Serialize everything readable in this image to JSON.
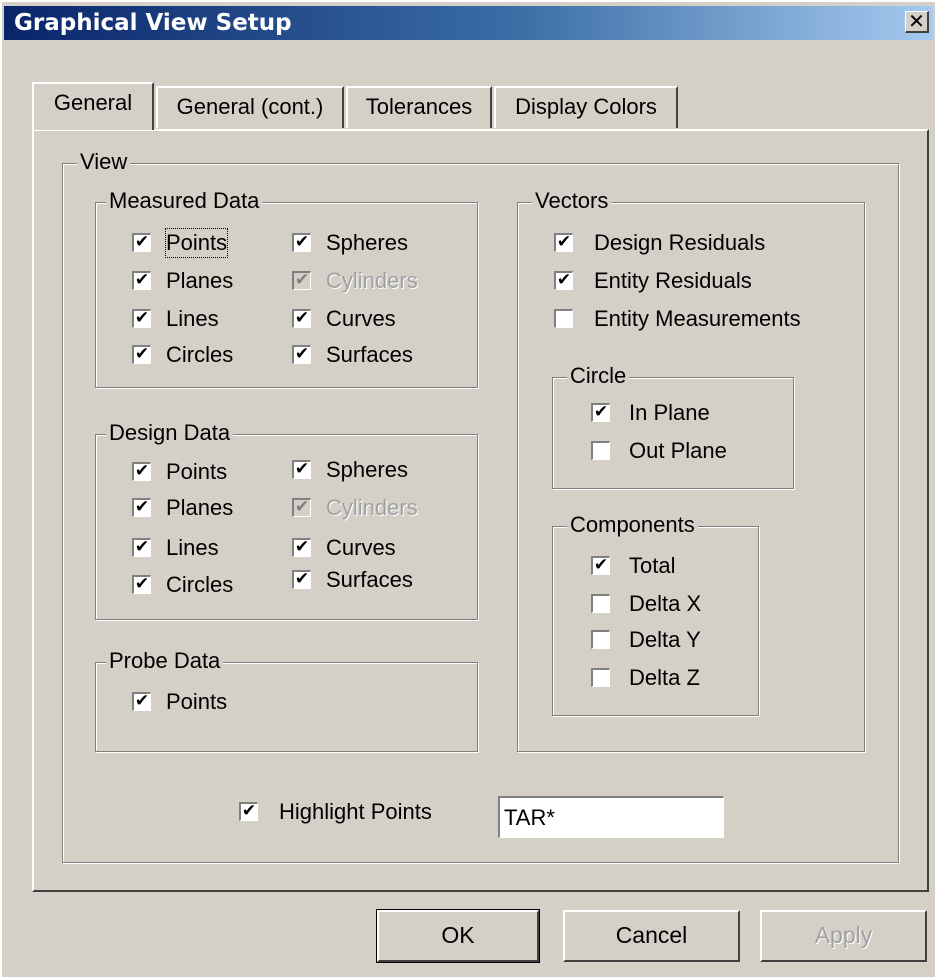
{
  "window": {
    "title": "Graphical View Setup",
    "close_glyph": "✕",
    "close_icon": "close-icon"
  },
  "tabs": [
    {
      "label": "General",
      "active": true
    },
    {
      "label": "General (cont.)",
      "active": false
    },
    {
      "label": "Tolerances",
      "active": false
    },
    {
      "label": "Display Colors",
      "active": false
    }
  ],
  "view": {
    "label": "View",
    "measured": {
      "label": "Measured Data",
      "items": [
        {
          "label": "Points",
          "checked": true,
          "enabled": true
        },
        {
          "label": "Planes",
          "checked": true,
          "enabled": true
        },
        {
          "label": "Lines",
          "checked": true,
          "enabled": true
        },
        {
          "label": "Circles",
          "checked": true,
          "enabled": true
        },
        {
          "label": "Spheres",
          "checked": true,
          "enabled": true
        },
        {
          "label": "Cylinders",
          "checked": true,
          "enabled": false
        },
        {
          "label": "Curves",
          "checked": true,
          "enabled": true
        },
        {
          "label": "Surfaces",
          "checked": true,
          "enabled": true
        }
      ]
    },
    "design": {
      "label": "Design Data",
      "items": [
        {
          "label": "Points",
          "checked": true,
          "enabled": true
        },
        {
          "label": "Planes",
          "checked": true,
          "enabled": true
        },
        {
          "label": "Lines",
          "checked": true,
          "enabled": true
        },
        {
          "label": "Circles",
          "checked": true,
          "enabled": true
        },
        {
          "label": "Spheres",
          "checked": true,
          "enabled": true
        },
        {
          "label": "Cylinders",
          "checked": true,
          "enabled": false
        },
        {
          "label": "Curves",
          "checked": true,
          "enabled": true
        },
        {
          "label": "Surfaces",
          "checked": true,
          "enabled": true
        }
      ]
    },
    "probe": {
      "label": "Probe Data",
      "items": [
        {
          "label": "Points",
          "checked": true,
          "enabled": true
        }
      ]
    },
    "vectors": {
      "label": "Vectors",
      "items": [
        {
          "label": "Design Residuals",
          "checked": true,
          "enabled": true
        },
        {
          "label": "Entity Residuals",
          "checked": true,
          "enabled": true
        },
        {
          "label": "Entity Measurements",
          "checked": false,
          "enabled": true
        }
      ],
      "circle": {
        "label": "Circle",
        "items": [
          {
            "label": "In Plane",
            "checked": true,
            "enabled": true
          },
          {
            "label": "Out Plane",
            "checked": false,
            "enabled": true
          }
        ]
      },
      "components": {
        "label": "Components",
        "items": [
          {
            "label": "Total",
            "checked": true,
            "enabled": true
          },
          {
            "label": "Delta X",
            "checked": false,
            "enabled": true
          },
          {
            "label": "Delta Y",
            "checked": false,
            "enabled": true
          },
          {
            "label": "Delta Z",
            "checked": false,
            "enabled": true
          }
        ]
      }
    },
    "highlight": {
      "label": "Highlight Points",
      "checked": true,
      "value": "TAR*"
    }
  },
  "buttons": {
    "ok": "OK",
    "cancel": "Cancel",
    "apply": "Apply",
    "apply_enabled": false
  },
  "colors": {
    "face": "#d4d0c8",
    "title_start": "#0a246a",
    "title_end": "#a6caf0",
    "disabled_text": "#a0a0a0"
  },
  "check_glyph": "✔"
}
